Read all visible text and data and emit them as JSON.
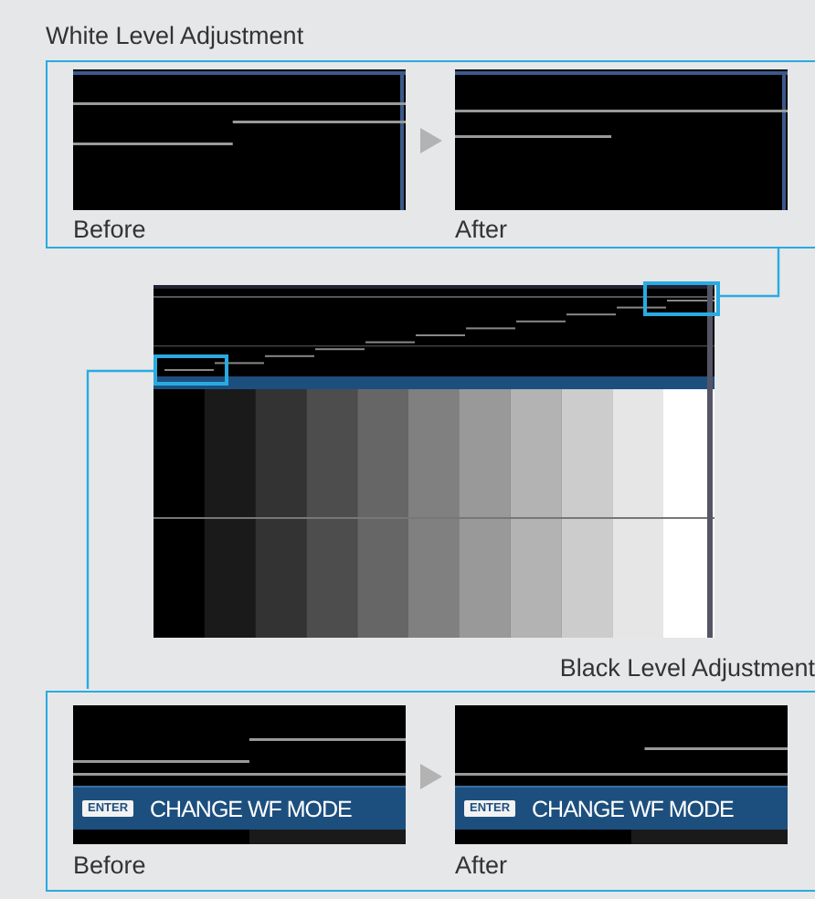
{
  "white_level": {
    "title": "White Level Adjustment",
    "panels": [
      {
        "label": "Before",
        "kind": "white_before"
      },
      {
        "label": "After",
        "kind": "white_after"
      }
    ]
  },
  "black_level": {
    "title": "Black Level Adjustment",
    "panels": [
      {
        "label": "Before",
        "kind": "black_before",
        "key": "ENTER",
        "action": "CHANGE WF MODE"
      },
      {
        "label": "After",
        "kind": "black_after",
        "key": "ENTER",
        "action": "CHANGE WF MODE"
      }
    ]
  }
}
